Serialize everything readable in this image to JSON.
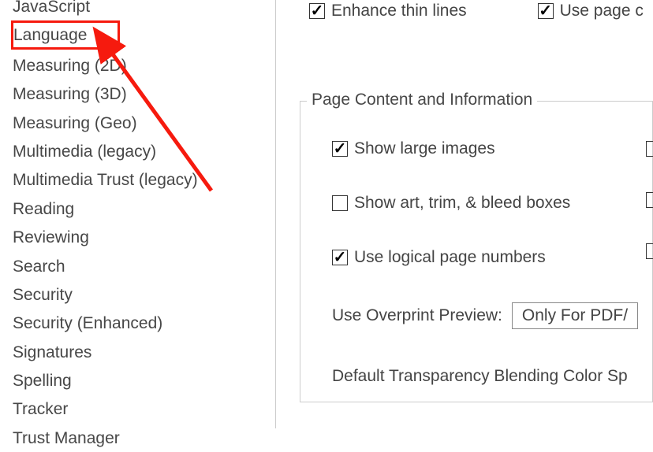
{
  "sidebar": {
    "items": [
      "JavaScript",
      "Language",
      "Measuring (2D)",
      "Measuring (3D)",
      "Measuring (Geo)",
      "Multimedia (legacy)",
      "Multimedia Trust (legacy)",
      "Reading",
      "Reviewing",
      "Search",
      "Security",
      "Security (Enhanced)",
      "Signatures",
      "Spelling",
      "Tracker",
      "Trust Manager"
    ]
  },
  "main": {
    "top_checkboxes": {
      "enhance": {
        "label": "Enhance thin lines",
        "checked": true
      },
      "use_page": {
        "label": "Use page c",
        "checked": true
      }
    },
    "fieldset_legend": "Page Content and Information",
    "options": {
      "show_large_images": {
        "label": "Show large images",
        "checked": true
      },
      "show_art_trim": {
        "label": "Show art, trim, & bleed boxes",
        "checked": false
      },
      "use_logical": {
        "label": "Use logical page numbers",
        "checked": true
      }
    },
    "overprint_label": "Use Overprint Preview:",
    "overprint_value": "Only For PDF/",
    "transparency_label": "Default Transparency Blending Color Sp"
  },
  "highlighted_index": 1
}
